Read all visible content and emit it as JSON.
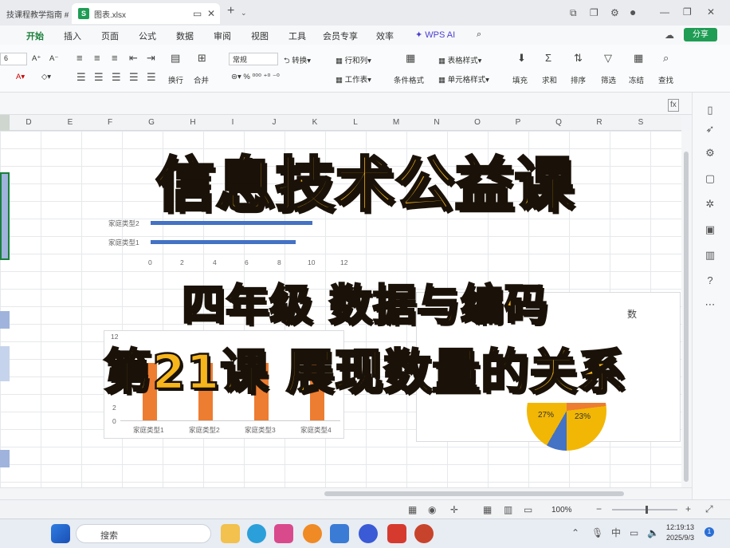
{
  "tabs": [
    {
      "label": "技课程教学指南 #"
    },
    {
      "label": "图表.xlsx",
      "icon": "S"
    }
  ],
  "menu": [
    "开始",
    "插入",
    "页面",
    "公式",
    "数据",
    "审阅",
    "视图",
    "工具",
    "会员专享",
    "效率",
    "WPS AI"
  ],
  "share_label": "分享",
  "ribbon": {
    "font_size": "6",
    "number_format": "常规",
    "convert": "转换",
    "rows_cols": "行和列",
    "worksheet": "工作表",
    "table_style": "表格样式",
    "cell_style": "单元格样式",
    "cond_format": "条件格式",
    "wrap": "换行",
    "merge": "合并",
    "fill": "填充",
    "sum": "求和",
    "sort": "排序",
    "filter": "筛选",
    "freeze": "冻结",
    "find": "查找"
  },
  "columns": [
    "D",
    "E",
    "F",
    "G",
    "H",
    "I",
    "J",
    "K",
    "L",
    "M",
    "N",
    "O",
    "P",
    "Q",
    "R",
    "S"
  ],
  "bar_chart": {
    "categories": [
      "家庭类型2",
      "家庭类型1"
    ],
    "axis_ticks": [
      "0",
      "2",
      "4",
      "6",
      "8",
      "10",
      "12"
    ],
    "label_partial": "数"
  },
  "col_chart": {
    "categories": [
      "家庭类型1",
      "家庭类型2",
      "家庭类型3",
      "家庭类型4"
    ],
    "y_ticks": [
      "12",
      "2",
      "0"
    ]
  },
  "pie_chart": {
    "title_partial": "数",
    "slices": [
      "27%",
      "23%"
    ]
  },
  "overlay": {
    "title": "信息技术公益课",
    "subtitle1": "四年级 数据与编码",
    "subtitle2": "第21课 展现数量的关系"
  },
  "status": {
    "zoom": "100%"
  },
  "taskbar": {
    "search": "搜索",
    "time": "12:19:13",
    "date": "2025/9/3",
    "ime": "中"
  },
  "chart_data": [
    {
      "type": "bar",
      "categories": [
        "家庭类型1",
        "家庭类型2"
      ],
      "values": [
        9,
        10
      ],
      "xlim": [
        0,
        12
      ],
      "color": "#4472c4"
    },
    {
      "type": "bar",
      "categories": [
        "家庭类型1",
        "家庭类型2",
        "家庭类型3",
        "家庭类型4"
      ],
      "values": [
        null,
        null,
        null,
        null
      ],
      "ylim": [
        0,
        12
      ],
      "color": "#ed7d31"
    },
    {
      "type": "pie",
      "labels": [
        "27%",
        "23%"
      ],
      "values": [
        27,
        23
      ],
      "colors": [
        "#f2b705",
        "#ed7d31"
      ]
    }
  ]
}
